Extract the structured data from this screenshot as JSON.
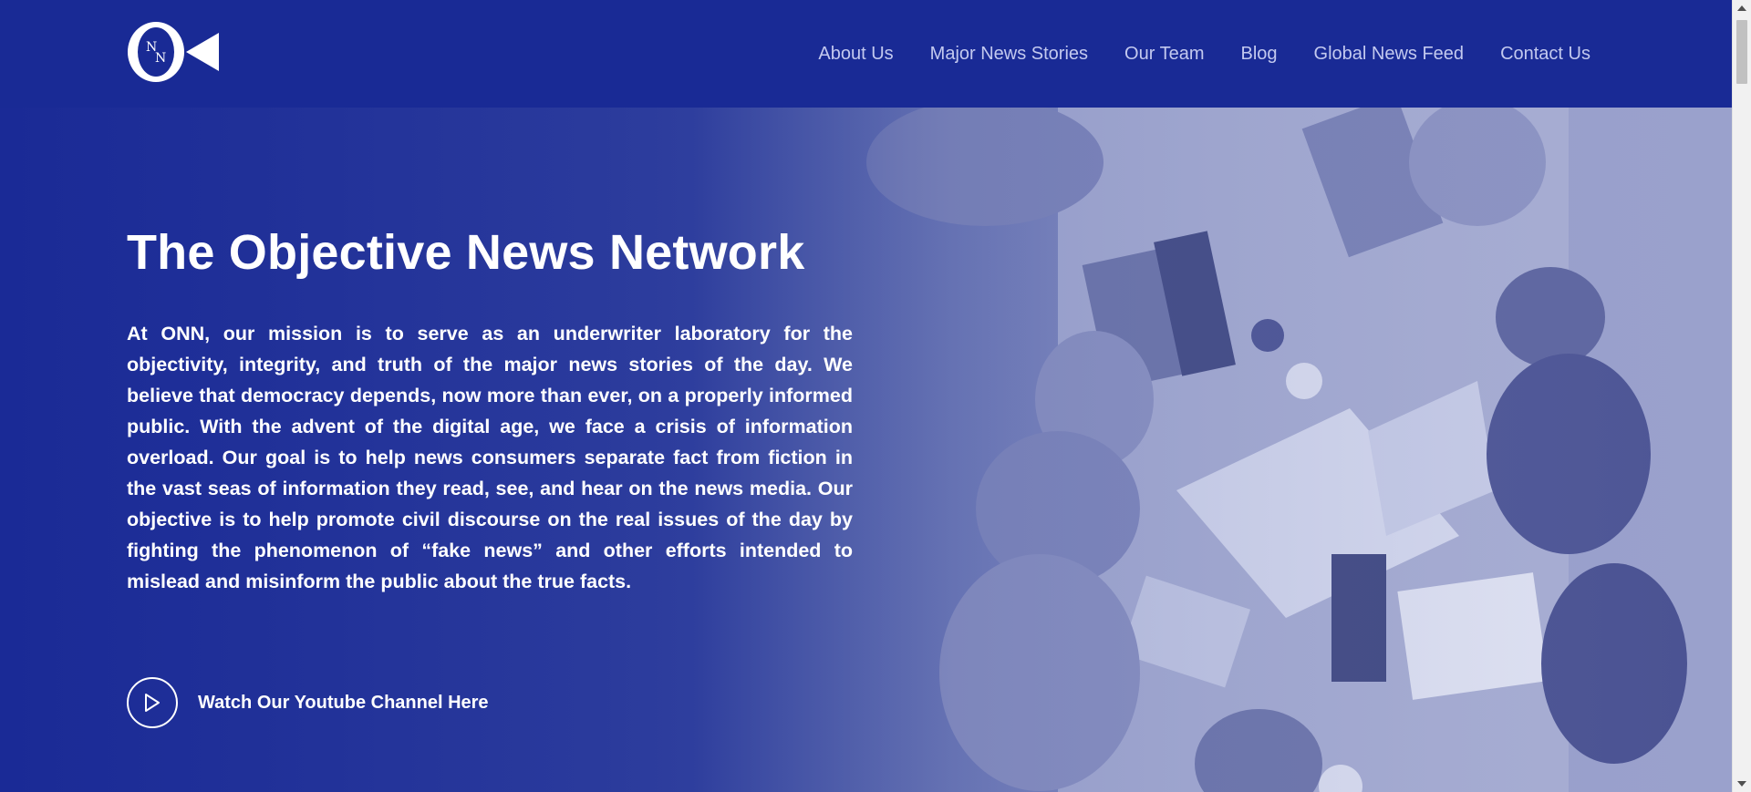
{
  "brand": {
    "logo_name": "ONN logo"
  },
  "nav": [
    {
      "label": "About Us"
    },
    {
      "label": "Major News Stories"
    },
    {
      "label": "Our Team"
    },
    {
      "label": "Blog"
    },
    {
      "label": "Global News Feed"
    },
    {
      "label": "Contact Us"
    }
  ],
  "hero": {
    "title": "The Objective News Network",
    "body": "At ONN, our mission is to serve as an underwriter laboratory for the objectivity, integrity, and truth of the major news stories of the day. We believe that democracy depends, now more than ever, on a properly informed public. With the advent of the digital age, we face a crisis of information overload. Our goal is to help news consumers separate fact from fiction in the vast seas of information they read, see, and hear on the news media. Our objective is to help promote civil discourse on the real issues of the day by fighting the phenomenon of “fake news” and other efforts intended to mislead and misinform the public about the true facts.",
    "cta_label": "Watch Our Youtube Channel Here",
    "cta_icon": "play-icon",
    "background_image": "overhead view of people meeting around a table"
  },
  "colors": {
    "header_bg": "#192a95",
    "nav_text": "#c3c9ef",
    "hero_text": "#ffffff"
  }
}
